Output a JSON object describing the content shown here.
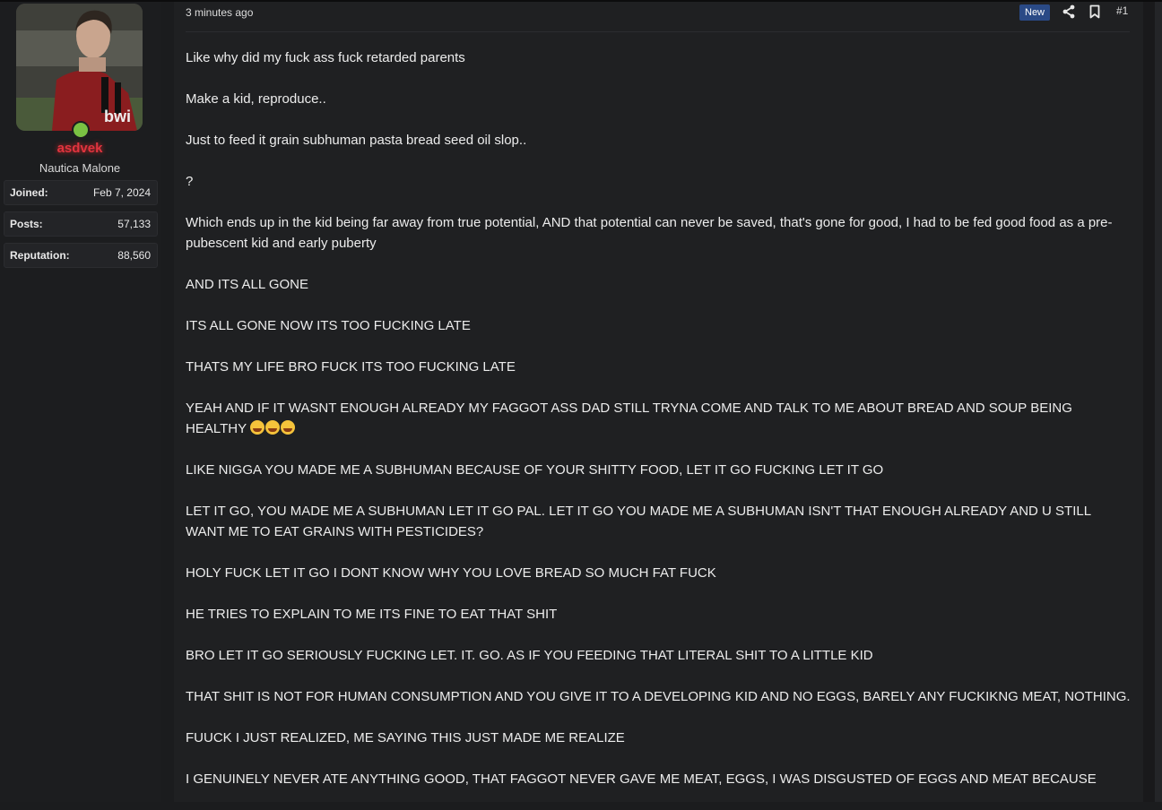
{
  "user": {
    "username": "asdvek",
    "title": "Nautica Malone",
    "stats": [
      {
        "label": "Joined:",
        "value": "Feb 7, 2024"
      },
      {
        "label": "Posts:",
        "value": "57,133"
      },
      {
        "label": "Reputation:",
        "value": "88,560"
      }
    ],
    "online_color": "#7ac143",
    "username_color": "#e0343f"
  },
  "post": {
    "timestamp": "3 minutes ago",
    "badge": "New",
    "number": "#1",
    "paragraphs": [
      "Like why did my fuck ass fuck retarded parents",
      "Make a kid, reproduce..",
      "Just to feed it grain subhuman pasta bread seed oil slop..",
      "?",
      "Which ends up in the kid being far away from true potential, AND that potential can never be saved, that's gone for good, I had to be fed good food as a pre-pubescent kid and early puberty",
      "AND ITS ALL GONE",
      "ITS ALL GONE NOW ITS TOO FUCKING LATE",
      "THATS MY LIFE BRO FUCK ITS TOO FUCKING LATE",
      "YEAH AND IF IT WASNT ENOUGH ALREADY MY FAGGOT ASS DAD STILL TRYNA COME AND TALK TO ME ABOUT BREAD AND SOUP BEING HEALTHY",
      "LIKE NIGGA YOU MADE ME A SUBHUMAN BECAUSE OF YOUR SHITTY FOOD, LET IT GO FUCKING LET IT GO",
      "LET IT GO, YOU MADE ME A SUBHUMAN LET IT GO PAL. LET IT GO YOU MADE ME A SUBHUMAN ISN'T THAT ENOUGH ALREADY AND U STILL WANT ME TO EAT GRAINS WITH PESTICIDES?",
      "HOLY FUCK LET IT GO I DONT KNOW WHY YOU LOVE BREAD SO MUCH FAT FUCK",
      "HE TRIES TO EXPLAIN TO ME ITS FINE TO EAT THAT SHIT",
      "BRO LET IT GO SERIOUSLY FUCKING LET. IT. GO. AS IF YOU FEEDING THAT LITERAL SHIT TO A LITTLE KID",
      "THAT SHIT IS NOT FOR HUMAN CONSUMPTION AND YOU GIVE IT TO A DEVELOPING KID AND NO EGGS, BARELY ANY FUCKIKNG MEAT, NOTHING.",
      "FUUCK I JUST REALIZED, ME SAYING THIS JUST MADE ME REALIZE",
      "I GENUINELY NEVER ATE ANYTHING GOOD, THAT FAGGOT NEVER GAVE ME MEAT, EGGS, I WAS DISGUSTED OF EGGS AND MEAT BECAUSE"
    ],
    "badge_color": "#2a4a86"
  }
}
